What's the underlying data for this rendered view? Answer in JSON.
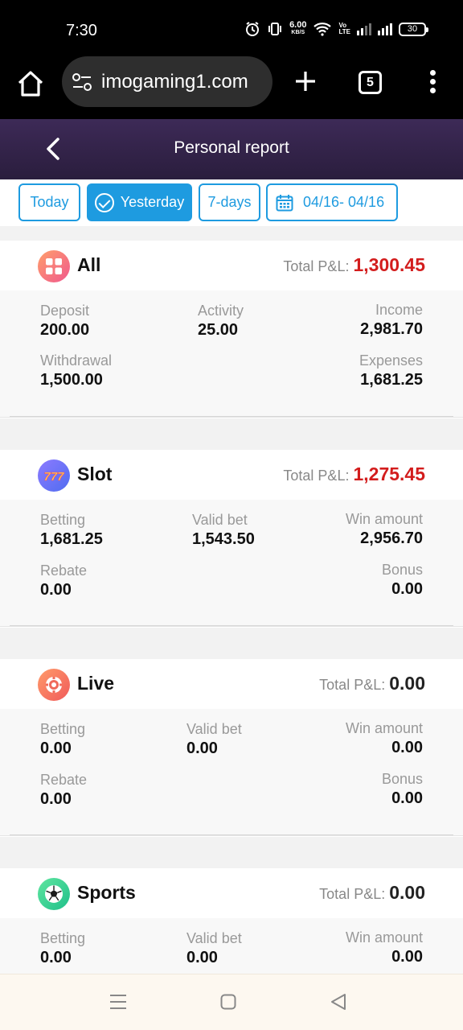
{
  "status_bar": {
    "time": "7:30",
    "net_speed": "6.00",
    "net_unit": "KB/S",
    "volte_top": "Vo",
    "volte_bottom": "LTE",
    "battery": "30"
  },
  "browser": {
    "url": "imogaming1.com",
    "tab_count": "5"
  },
  "header": {
    "title": "Personal report"
  },
  "filters": {
    "today": "Today",
    "yesterday": "Yesterday",
    "seven_days": "7-days",
    "date_range": "04/16- 04/16",
    "active": "yesterday"
  },
  "cards": [
    {
      "name": "All",
      "pl_label": "Total P&L:",
      "pl_value": "1,300.45",
      "stats": [
        {
          "label": "Deposit",
          "value": "200.00"
        },
        {
          "label": "Activity",
          "value": "25.00"
        },
        {
          "label": "Income",
          "value": "2,981.70"
        },
        {
          "label": "Withdrawal",
          "value": "1,500.00"
        },
        {
          "label": "Expenses",
          "value": "1,681.25"
        }
      ]
    },
    {
      "name": "Slot",
      "pl_label": "Total P&L:",
      "pl_value": "1,275.45",
      "stats": [
        {
          "label": "Betting",
          "value": "1,681.25"
        },
        {
          "label": "Valid bet",
          "value": "1,543.50"
        },
        {
          "label": "Win amount",
          "value": "2,956.70"
        },
        {
          "label": "Rebate",
          "value": "0.00"
        },
        {
          "label": "Bonus",
          "value": "0.00"
        }
      ]
    },
    {
      "name": "Live",
      "pl_label": "Total P&L:",
      "pl_value": "0.00",
      "stats": [
        {
          "label": "Betting",
          "value": "0.00"
        },
        {
          "label": "Valid bet",
          "value": "0.00"
        },
        {
          "label": "Win amount",
          "value": "0.00"
        },
        {
          "label": "Rebate",
          "value": "0.00"
        },
        {
          "label": "Bonus",
          "value": "0.00"
        }
      ]
    },
    {
      "name": "Sports",
      "pl_label": "Total P&L:",
      "pl_value": "0.00",
      "stats": [
        {
          "label": "Betting",
          "value": "0.00"
        },
        {
          "label": "Valid bet",
          "value": "0.00"
        },
        {
          "label": "Win amount",
          "value": "0.00"
        }
      ]
    }
  ],
  "colors": {
    "accent": "#1e9be0",
    "positive_pl": "#d31d1d",
    "header_bg": "#3d2a57"
  },
  "icons": {
    "all": "grid-icon",
    "slot": "slot-777-icon",
    "live": "poker-chip-icon",
    "sports": "soccer-ball-icon"
  }
}
